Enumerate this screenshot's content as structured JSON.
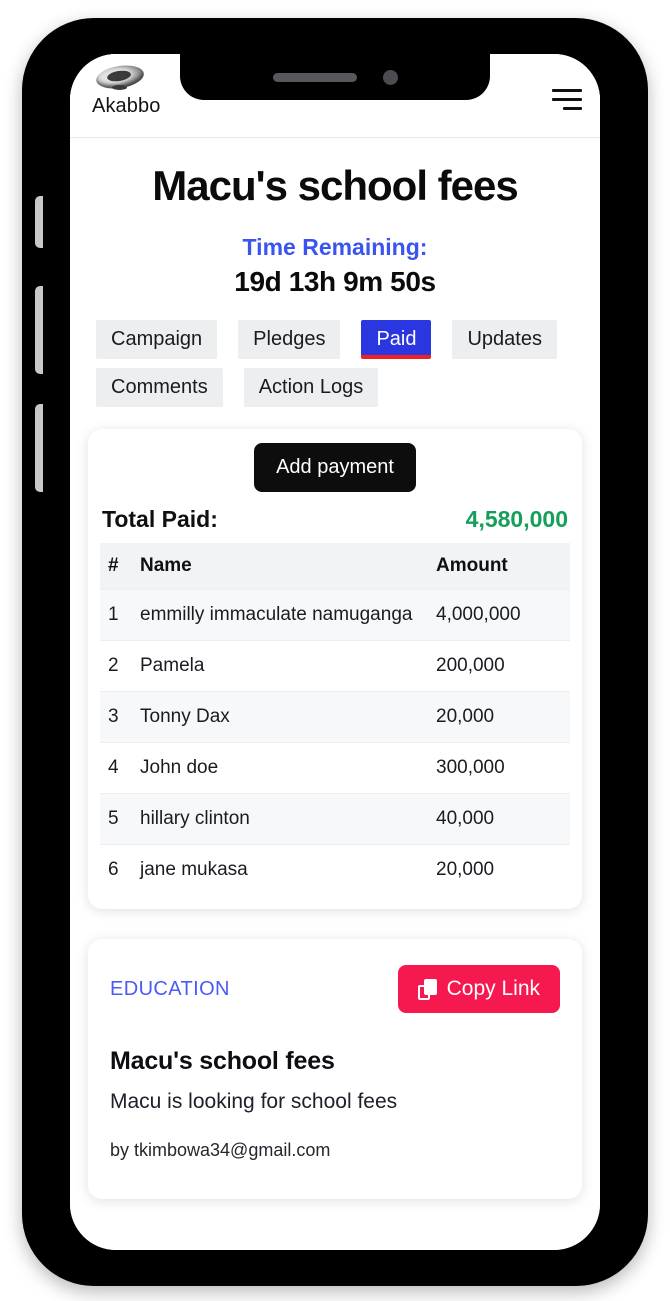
{
  "header": {
    "brand_name": "Akabbo",
    "logo_icon": "akabbo-bowl-logo",
    "menu_icon": "hamburger-menu-icon"
  },
  "campaign": {
    "title": "Macu's school fees",
    "time_remaining_label": "Time Remaining:",
    "time_remaining_value": "19d 13h 9m 50s"
  },
  "tabs": [
    {
      "label": "Campaign",
      "active": false
    },
    {
      "label": "Pledges",
      "active": false
    },
    {
      "label": "Paid",
      "active": true
    },
    {
      "label": "Updates",
      "active": false
    },
    {
      "label": "Comments",
      "active": false
    },
    {
      "label": "Action Logs",
      "active": false
    }
  ],
  "paid_panel": {
    "add_payment_label": "Add payment",
    "total_paid_label": "Total Paid:",
    "total_paid_value": "4,580,000",
    "columns": [
      "#",
      "Name",
      "Amount"
    ],
    "rows": [
      {
        "index": "1",
        "name": "emmilly immaculate namuganga",
        "amount": "4,000,000"
      },
      {
        "index": "2",
        "name": "Pamela",
        "amount": "200,000"
      },
      {
        "index": "3",
        "name": "Tonny Dax",
        "amount": "20,000"
      },
      {
        "index": "4",
        "name": "John doe",
        "amount": "300,000"
      },
      {
        "index": "5",
        "name": "hillary clinton",
        "amount": "40,000"
      },
      {
        "index": "6",
        "name": "jane mukasa",
        "amount": "20,000"
      }
    ]
  },
  "info_card": {
    "category": "EDUCATION",
    "copy_link_label": "Copy Link",
    "copy_icon": "copy-icon",
    "title": "Macu's school fees",
    "description": "Macu is looking for school fees",
    "author": "by tkimbowa34@gmail.com"
  },
  "colors": {
    "accent_blue": "#3b54f0",
    "active_tab_blue": "#2a36e0",
    "active_tab_underline_red": "#ef2020",
    "total_paid_green": "#14a05a",
    "copy_link_pink": "#f5194f",
    "category_blue": "#4b5bf5",
    "tab_background": "#eceef0",
    "add_payment_black": "#0d0d0d"
  }
}
